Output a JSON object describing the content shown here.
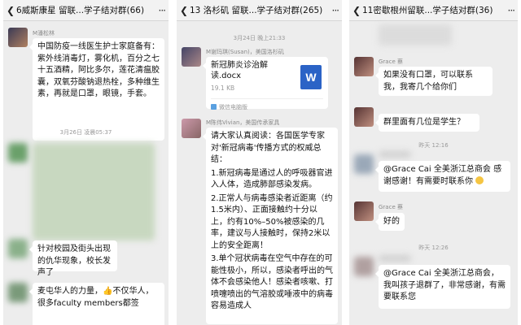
{
  "panels": [
    {
      "title": "6威斯康星 留联...学子结对群(66)",
      "sender": "M潘松林",
      "message": "中国防疫一线医生护士家庭备有：紫外线消毒灯，雾化机，百分之七十五酒精，阿比多尔，莲花清瘟胶囊，双氧芬酸钠退热栓，多种维生素，再就是口罩，眼镜，手套。",
      "time": "3月26日 凌晨05:37",
      "message2": "针对校园及街头出现的仇华现象，校长发声了",
      "message3": "麦屯华人的力量，👍不仅华人，很多faculty members都签"
    },
    {
      "title": "13 洛杉矶 留联...学子结对群(265)",
      "time": "3月24日 晚上21:33",
      "sender1": "M谢玛琪(Susan)，美国洛杉矶",
      "file": {
        "name": "新冠肺炎诊治解读.docx",
        "size": "19.1 KB",
        "source": "微信电脑版",
        "icon_letter": "W"
      },
      "sender2": "M陈伟Vivian，美国传承家具",
      "paragraphs": [
        "请大家认真阅读：各国医学专家对'新冠病毒'传播方式的权威总结：",
        "1.新冠病毒是通过人的呼吸器官进入人体，造成肺部感染发病。",
        "2.正常人与病毒感染者近距离（约1.5米内）、正面接触约十分以上，约有10%–50%被感染的几率，建议与人接触时，保持2米以上的安全距离！",
        "3.单个冠状病毒在空气中存在的可能性极小，所以，感染者呼出的气体不会感染他人！感染者咳嗽、打喷嚏喷出的气溶胶或唾液中的病毒容易造成人"
      ]
    },
    {
      "title": "11密歇根州留联...学子结对群(36)",
      "sender": "Grace 蔡",
      "msg1": "如果没有口罩，可以联系我，我寄几个给你们",
      "msg2": "群里面有几位是学生？",
      "time1": "昨天 12:16",
      "msg3": "@Grace Cai 全美浙江总商会 感谢感谢！有需要时联系你",
      "msg4": "好的",
      "time2": "昨天 12:26",
      "msg5": "@Grace Cai 全美浙江总商会，我叫孩子退群了，非常感谢，有需要联系您"
    }
  ],
  "icons": {
    "back": "back-arrow-icon",
    "more": "more-dots-icon",
    "word": "word-doc-icon"
  },
  "colors": {
    "chat_bg": "#ededed",
    "bubble": "#ffffff",
    "word_blue": "#2b63c6"
  }
}
